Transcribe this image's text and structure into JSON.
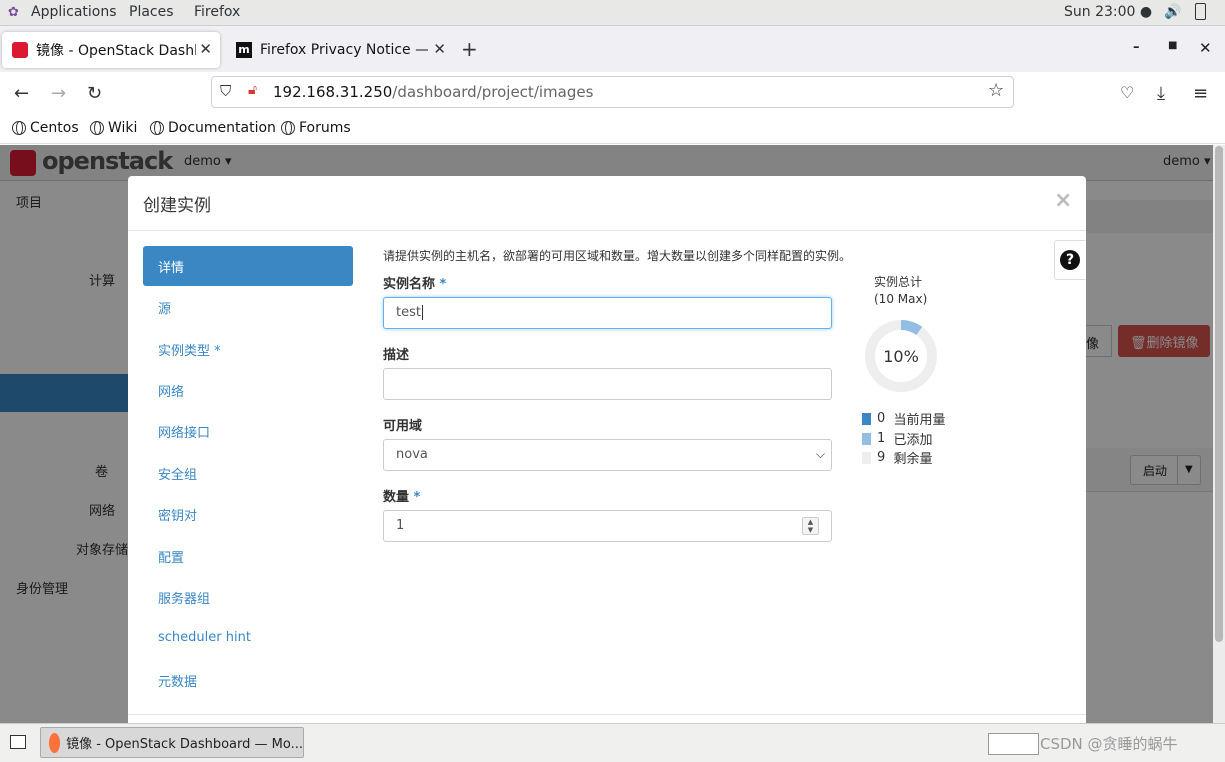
{
  "gnome": {
    "applications": "Applications",
    "places": "Places",
    "firefox": "Firefox",
    "clock": "Sun 23:00 ●"
  },
  "tabs": [
    {
      "title": "镜像 - OpenStack Dashbo"
    },
    {
      "title": "Firefox Privacy Notice — N"
    }
  ],
  "url": {
    "host": "192.168.31.250",
    "path": "/dashboard/project/images"
  },
  "bookmarks": [
    "Centos",
    "Wiki",
    "Documentation",
    "Forums"
  ],
  "openstack": {
    "logo": "openstack",
    "project_selector": "demo ▾",
    "user_menu": "demo ▾",
    "sidebar": {
      "project": "项目",
      "compute": "计算",
      "volumes": "卷",
      "network": "网络",
      "object_store": "对象存储",
      "identity": "身份管理"
    },
    "actions": {
      "image_tail": "像",
      "delete_images": "删除镜像",
      "launch": "启动"
    }
  },
  "modal": {
    "title": "创建实例",
    "close": "×",
    "help": "?",
    "nav": [
      {
        "label": "详情",
        "required": false
      },
      {
        "label": "源",
        "required": false
      },
      {
        "label": "实例类型",
        "required": true
      },
      {
        "label": "网络",
        "required": false
      },
      {
        "label": "网络接口",
        "required": false
      },
      {
        "label": "安全组",
        "required": false
      },
      {
        "label": "密钥对",
        "required": false
      },
      {
        "label": "配置",
        "required": false
      },
      {
        "label": "服务器组",
        "required": false
      },
      {
        "label": "scheduler hint",
        "required": false
      },
      {
        "label": "元数据",
        "required": false
      }
    ],
    "intro": "请提供实例的主机名，欲部署的可用区域和数量。增大数量以创建多个同样配置的实例。",
    "fields": {
      "name": {
        "label": "实例名称",
        "value": "test"
      },
      "description": {
        "label": "描述",
        "value": ""
      },
      "availability_zone": {
        "label": "可用域",
        "value": "nova"
      },
      "count": {
        "label": "数量",
        "value": "1"
      }
    },
    "quota": {
      "title": "实例总计",
      "max": "(10 Max)",
      "percent_text": "10%",
      "percent": 10,
      "legend": [
        {
          "count": "0",
          "label": "当前用量",
          "color": "#3a87c4"
        },
        {
          "count": "1",
          "label": "已添加",
          "color": "#93bde3"
        },
        {
          "count": "9",
          "label": "剩余量",
          "color": "#eeeeee"
        }
      ]
    }
  },
  "taskbar": {
    "window": "镜像 - OpenStack Dashboard — Mo...",
    "watermark": "CSDN @贪睡的蜗牛"
  }
}
